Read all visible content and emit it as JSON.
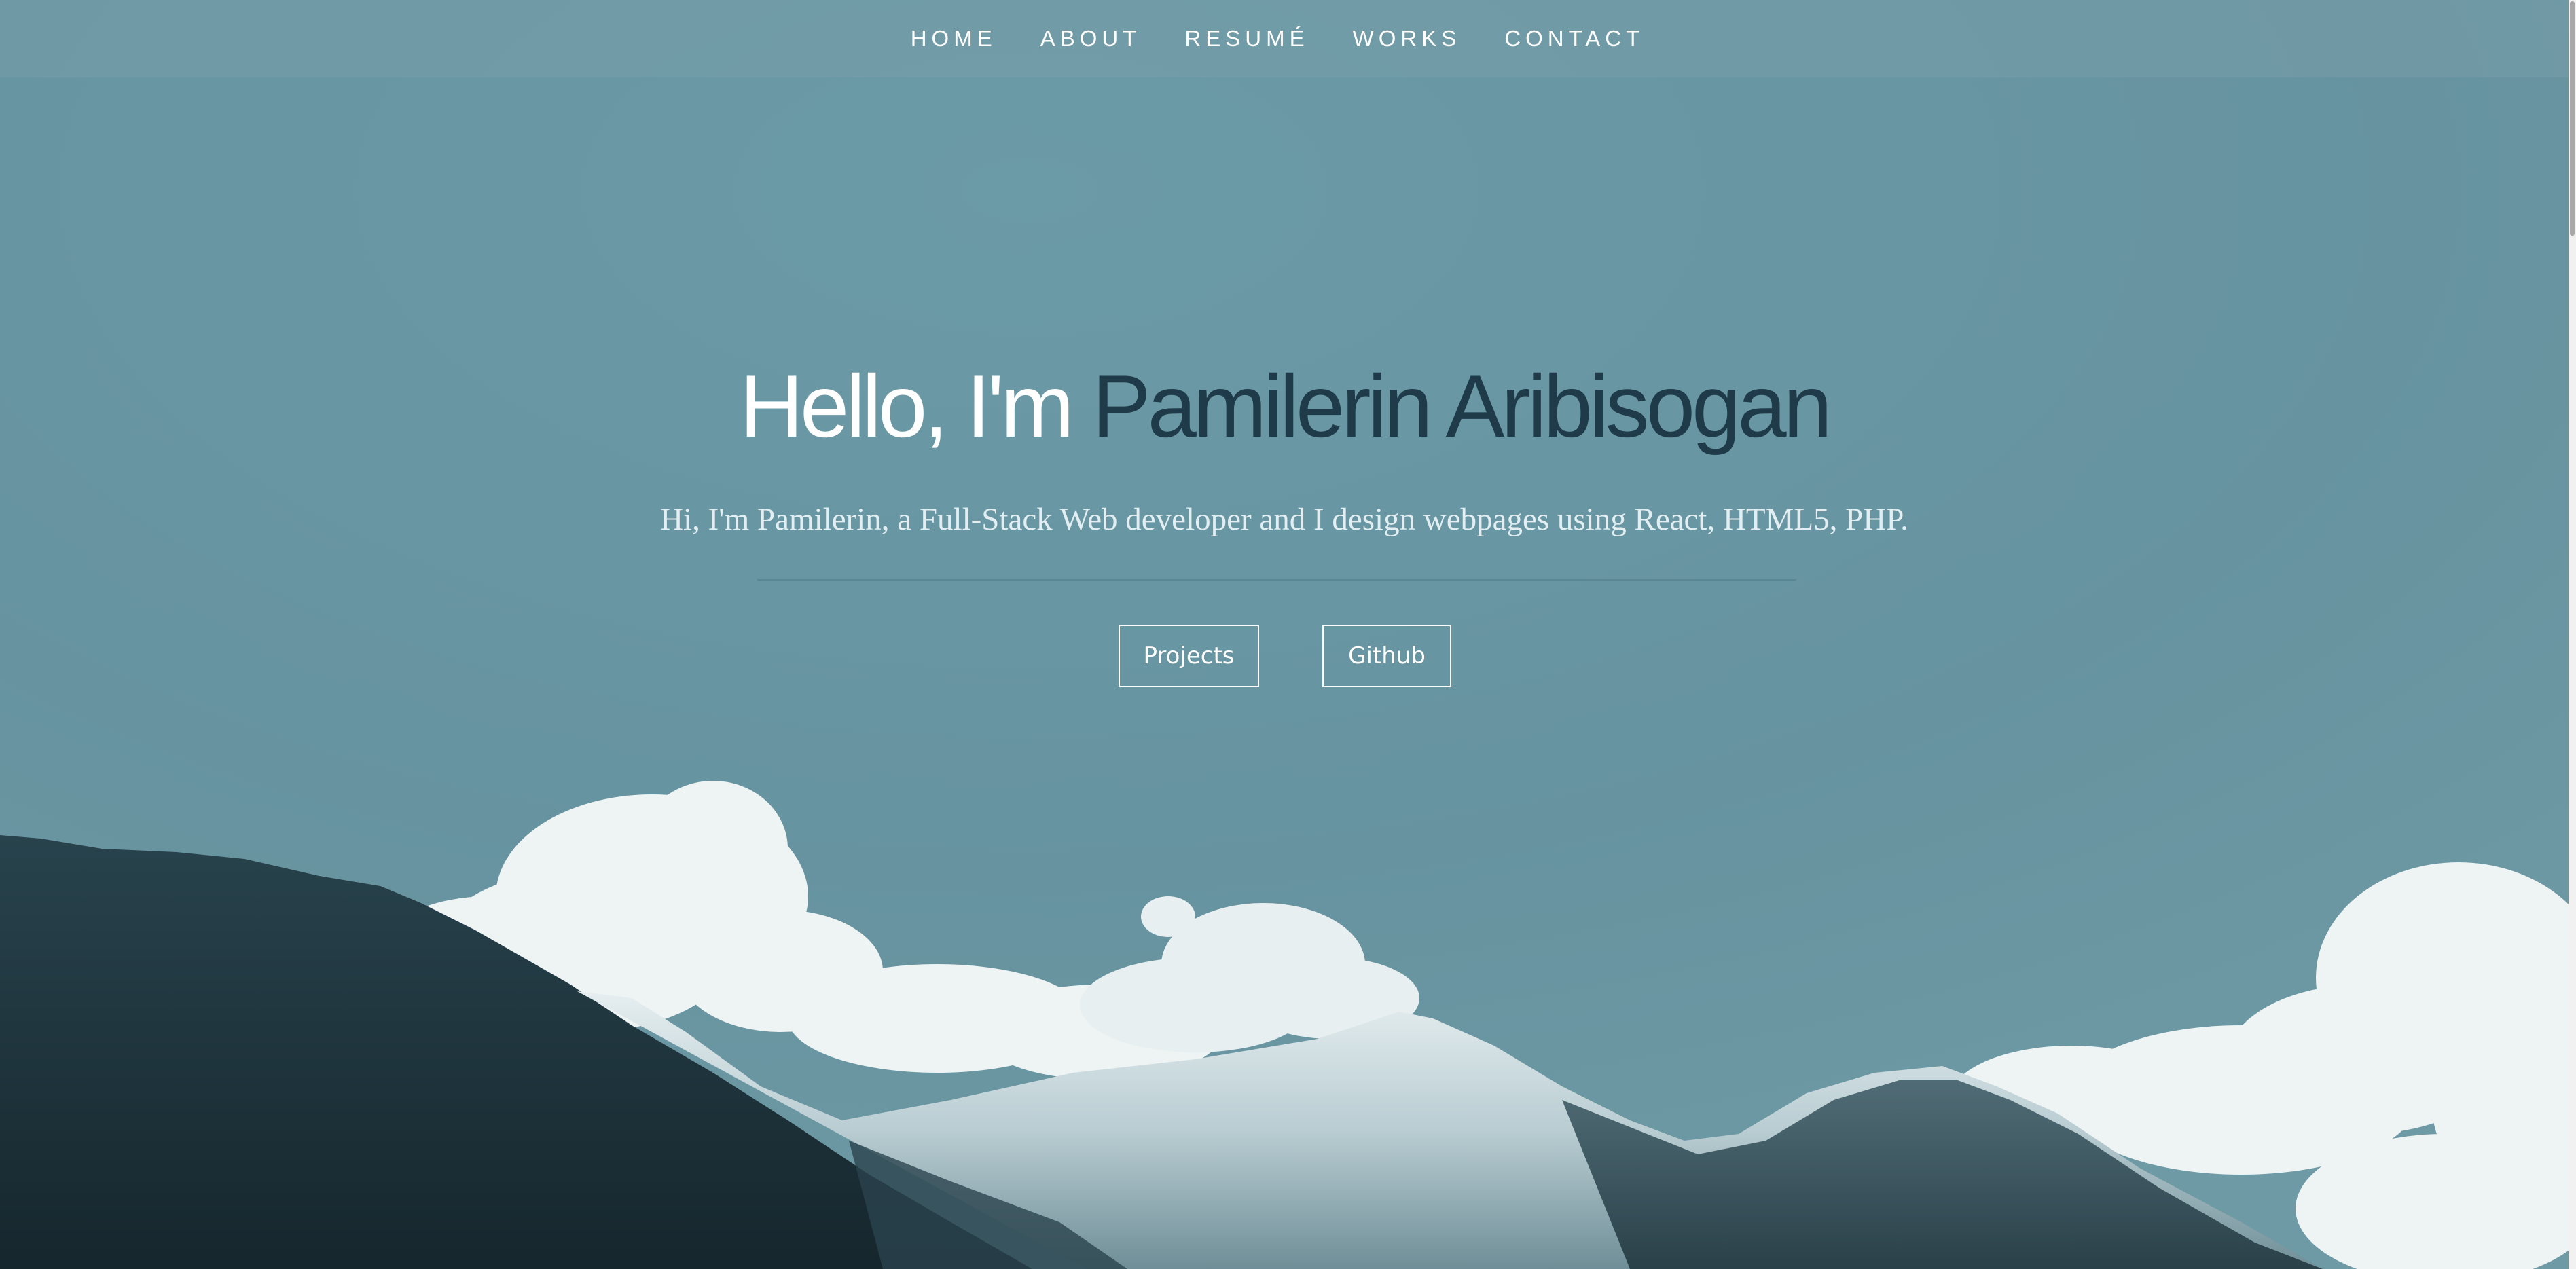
{
  "nav": {
    "items": [
      {
        "label": "HOME"
      },
      {
        "label": "ABOUT"
      },
      {
        "label": "RESUMÉ"
      },
      {
        "label": "WORKS"
      },
      {
        "label": "CONTACT"
      }
    ]
  },
  "hero": {
    "greeting": "Hello, I'm ",
    "name": "Pamilerin Aribisogan",
    "tagline": "Hi, I'm Pamilerin, a Full-Stack Web developer and I design webpages using React, HTML5, PHP.",
    "buttons": {
      "projects": "Projects",
      "github": "Github"
    }
  },
  "colors": {
    "sky": "#6696a2",
    "name_accent": "#1f3b4a",
    "text_light": "#ffffff"
  }
}
